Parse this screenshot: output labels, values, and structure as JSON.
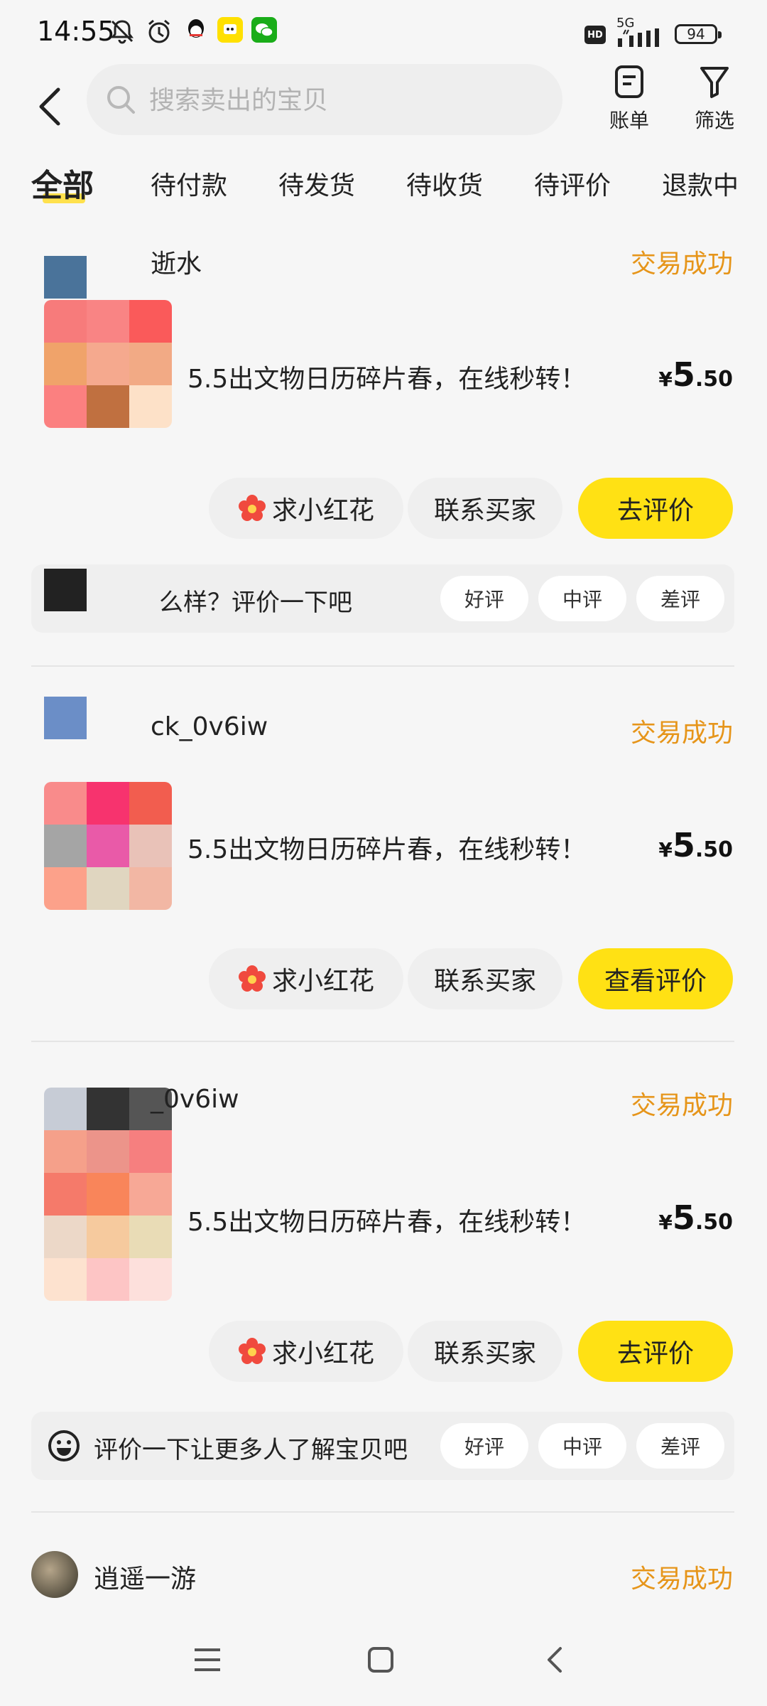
{
  "status_bar": {
    "time": "14:55",
    "hd": "HD",
    "network": "5G",
    "battery": "94",
    "apps": [
      "bell-off-icon",
      "alarm-icon",
      "qq-icon",
      "app-yellow-icon",
      "wechat-icon"
    ]
  },
  "header": {
    "search_placeholder": "搜索卖出的宝贝",
    "bill_label": "账单",
    "filter_label": "筛选"
  },
  "tabs": [
    "全部",
    "待付款",
    "待发货",
    "待收货",
    "待评价",
    "退款中"
  ],
  "orders": [
    {
      "seller": "逝水",
      "status": "交易成功",
      "title": "5.5出文物日历碎片春，在线秒转！",
      "price_symbol": "¥",
      "price_int": "5",
      "price_dec": ".50",
      "flower_label": "求小红花",
      "contact_label": "联系买家",
      "primary_label": "去评价",
      "review_prompt": "么样？评价一下吧",
      "rate_good": "好评",
      "rate_mid": "中评",
      "rate_bad": "差评"
    },
    {
      "seller": "ck_0v6iw",
      "status": "交易成功",
      "title": "5.5出文物日历碎片春，在线秒转！",
      "price_symbol": "¥",
      "price_int": "5",
      "price_dec": ".50",
      "flower_label": "求小红花",
      "contact_label": "联系买家",
      "primary_label": "查看评价"
    },
    {
      "seller": "_0v6iw",
      "status": "交易成功",
      "title": "5.5出文物日历碎片春，在线秒转！",
      "price_symbol": "¥",
      "price_int": "5",
      "price_dec": ".50",
      "flower_label": "求小红花",
      "contact_label": "联系买家",
      "primary_label": "去评价",
      "review_prompt": "评价一下让更多人了解宝贝吧",
      "rate_good": "好评",
      "rate_mid": "中评",
      "rate_bad": "差评"
    },
    {
      "seller": "逍遥一游",
      "status": "交易成功"
    }
  ],
  "colors": {
    "accent_yellow": "#ffe114",
    "status_orange": "#e6951a",
    "flower_red": "#f04a3e"
  }
}
